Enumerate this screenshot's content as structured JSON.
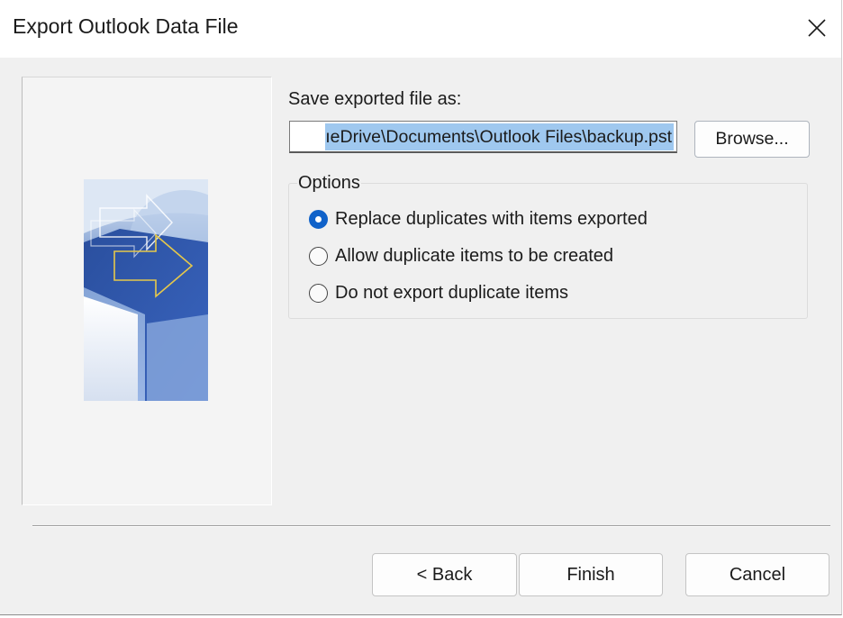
{
  "window": {
    "title": "Export Outlook Data File"
  },
  "icons": {
    "close": "close-icon"
  },
  "save": {
    "label": "Save exported file as:",
    "path_visible": "ıeDrive\\Documents\\Outlook Files\\backup.pst",
    "browse_label": "Browse..."
  },
  "options": {
    "legend": "Options",
    "items": [
      {
        "label": "Replace duplicates with items exported",
        "selected": true
      },
      {
        "label": "Allow duplicate items to be created",
        "selected": false
      },
      {
        "label": "Do not export duplicate items",
        "selected": false
      }
    ]
  },
  "footer": {
    "back_label": "< Back",
    "finish_label": "Finish",
    "cancel_label": "Cancel"
  },
  "colors": {
    "accent": "#1062c9",
    "selection": "#9fc8ef"
  }
}
